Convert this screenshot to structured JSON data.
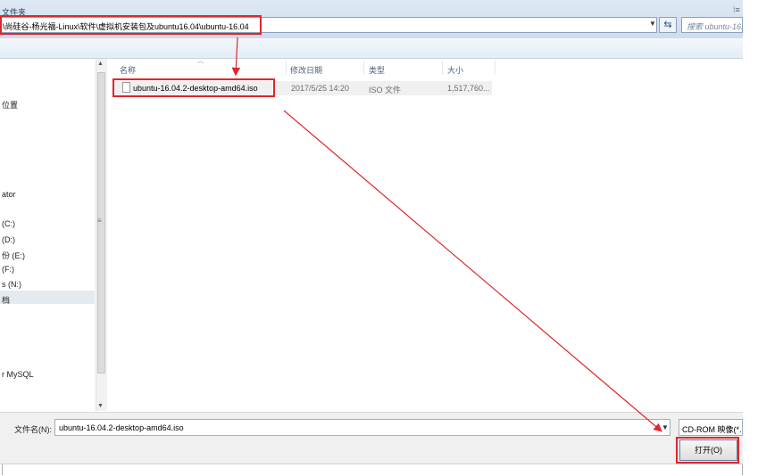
{
  "address": {
    "path": "\\尚硅谷-杨光福-Linux\\软件\\虚拟机安装包及ubuntu16.04\\ubuntu-16.04",
    "dropdown_icon": "chevron-down-icon",
    "refresh_icon": "refresh-icon",
    "search_placeholder": "搜索 ubuntu-16..."
  },
  "toolbar": {
    "new_folder": "文件夹",
    "view_icon": "view-icon"
  },
  "nav": {
    "items": [
      {
        "label": "位置"
      },
      {
        "label": "ator"
      },
      {
        "label": " (C:)"
      },
      {
        "label": " (D:)",
        "selected": true
      },
      {
        "label": "份 (E:)"
      },
      {
        "label": " (F:)"
      },
      {
        "label": "s (N:)"
      },
      {
        "label": "档"
      },
      {
        "label": "r MySQL"
      }
    ]
  },
  "columns": [
    "名称",
    "修改日期",
    "类型",
    "大小"
  ],
  "files": [
    {
      "name": "ubuntu-16.04.2-desktop-amd64.iso",
      "modified": "2017/5/25 14:20",
      "type": "ISO 文件",
      "size": "1,517,760..."
    }
  ],
  "bottom": {
    "filename_label": "文件名(N):",
    "filename_value": "ubuntu-16.04.2-desktop-amd64.iso",
    "filetype_value": "CD-ROM 映像(*.",
    "open_button": "打开(O)",
    "return_glyph": "↵"
  },
  "colors": {
    "annotation": "#e0262a"
  }
}
